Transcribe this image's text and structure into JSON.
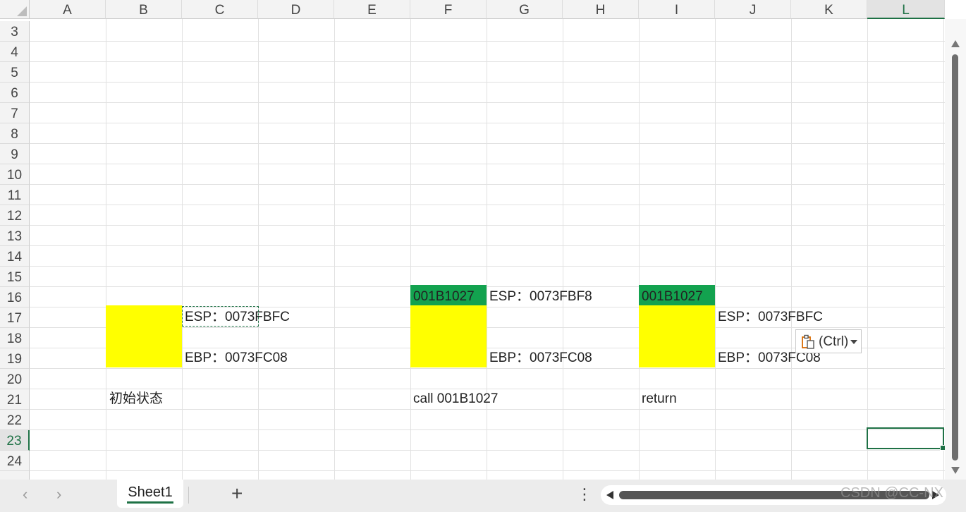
{
  "columns": [
    "A",
    "B",
    "C",
    "D",
    "E",
    "F",
    "G",
    "H",
    "I",
    "J",
    "K",
    "L"
  ],
  "selected_column": "L",
  "rows": [
    "3",
    "4",
    "5",
    "6",
    "7",
    "8",
    "9",
    "10",
    "11",
    "12",
    "13",
    "14",
    "15",
    "16",
    "17",
    "18",
    "19",
    "20",
    "21",
    "22",
    "23",
    "24"
  ],
  "selected_row": "23",
  "cells": {
    "B21": "初始状态",
    "C17": "ESP：0073FBFC",
    "C19": "EBP：0073FC08",
    "F16": "001B1027",
    "G16": "ESP：0073FBF8",
    "G19": "EBP：0073FC08",
    "F21": "call 001B1027",
    "I16": "001B1027",
    "J17": "ESP：0073FBFC",
    "J19": "EBP：0073FC08",
    "I21": "return"
  },
  "fill_colors": {
    "yellow": "#ffff00",
    "green": "#13a24f",
    "selection": "#1e7145"
  },
  "paste_options": {
    "label": "(Ctrl)",
    "icon": "clipboard-icon"
  },
  "sheet_tabs": [
    "Sheet1"
  ],
  "active_sheet": "Sheet1",
  "nav": {
    "prev": "‹",
    "next": "›",
    "add": "+",
    "more": "⋮"
  },
  "watermark": "CSDN @CC-NX"
}
